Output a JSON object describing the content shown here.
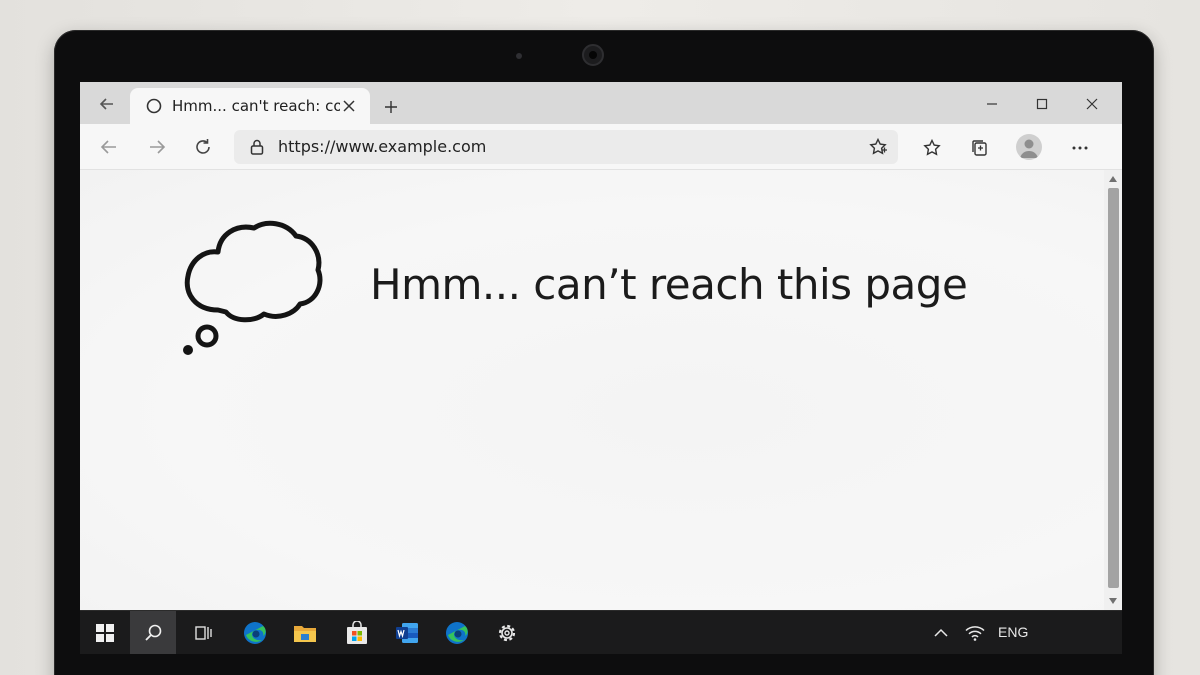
{
  "browser": {
    "tab": {
      "title": "Hmm... can't reach: com",
      "icon": "loading-circle-icon"
    },
    "address": {
      "url": "https://www.example.com",
      "icon": "lock-icon"
    },
    "toolbar_icons": [
      "favorites-add-icon",
      "favorites-icon",
      "collections-icon",
      "profile-avatar",
      "more-options-icon"
    ],
    "window_controls": [
      "minimize-icon",
      "maximize-icon",
      "close-icon"
    ]
  },
  "page": {
    "error_title": "Hmm... can’t reach this page",
    "illustration": "thought-cloud-icon"
  },
  "taskbar": {
    "apps": [
      "windows-start-icon",
      "search-icon",
      "task-view-icon",
      "edge-icon",
      "file-explorer-icon",
      "store-icon",
      "word-icon",
      "edge-icon",
      "settings-icon"
    ],
    "tray_language": "ENG",
    "tray_icons": [
      "chevron-up-icon",
      "wifi-icon"
    ]
  },
  "colors": {
    "bezel": "#0d0d0e",
    "tabbar": "#d9d9d9",
    "taskbar": "#1b1b1c",
    "edge_blue": "#0f73c9",
    "edge_green": "#35c25e"
  }
}
